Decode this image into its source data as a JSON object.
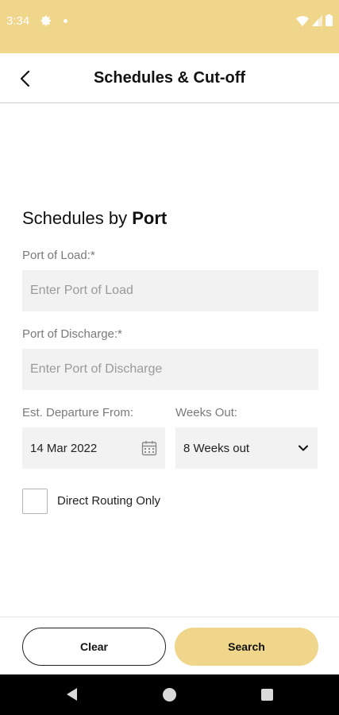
{
  "status_bar": {
    "time": "3:34",
    "background_color": "#efd68a",
    "icons": [
      "gear-icon",
      "notification-dot-icon",
      "wifi-icon",
      "signal-icon",
      "battery-icon"
    ]
  },
  "app_bar": {
    "back_icon": "chevron-left-icon",
    "title": "Schedules & Cut-off"
  },
  "form": {
    "section_title_prefix": "Schedules by ",
    "section_title_bold": "Port",
    "port_of_load": {
      "label": "Port of Load:*",
      "placeholder": "Enter Port of Load",
      "value": ""
    },
    "port_of_discharge": {
      "label": "Port of Discharge:*",
      "placeholder": "Enter Port of Discharge",
      "value": ""
    },
    "departure": {
      "label": "Est. Departure From:",
      "value": "14 Mar 2022",
      "icon": "calendar-icon"
    },
    "weeks_out": {
      "label": "Weeks Out:",
      "selected": "8 Weeks out",
      "icon": "chevron-down-icon"
    },
    "direct_routing": {
      "label": "Direct Routing Only",
      "checked": false
    }
  },
  "actions": {
    "clear_label": "Clear",
    "search_label": "Search",
    "accent_color": "#efd68a"
  },
  "nav_bar": {
    "icons": [
      "nav-back-icon",
      "nav-home-icon",
      "nav-recents-icon"
    ]
  }
}
